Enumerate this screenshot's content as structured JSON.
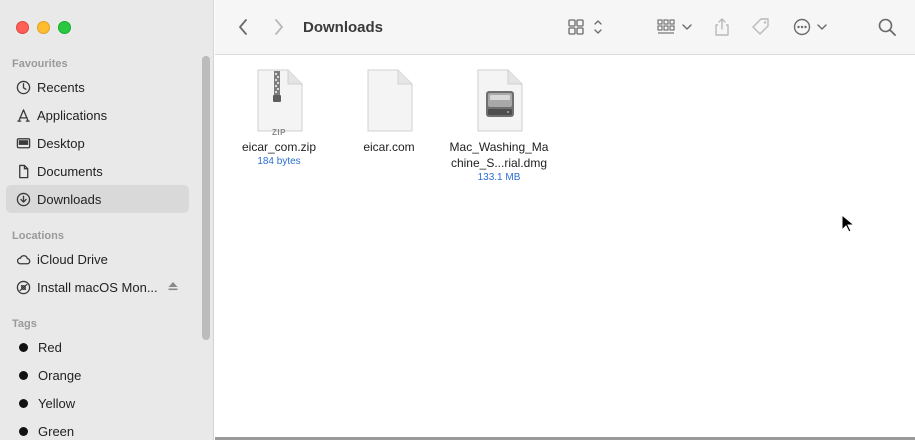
{
  "window": {
    "folder_title": "Downloads"
  },
  "sidebar": {
    "favourites_title": "Favourites",
    "favourites": [
      {
        "label": "Recents",
        "icon": "clock-icon"
      },
      {
        "label": "Applications",
        "icon": "applications-icon"
      },
      {
        "label": "Desktop",
        "icon": "desktop-icon"
      },
      {
        "label": "Documents",
        "icon": "document-icon"
      },
      {
        "label": "Downloads",
        "icon": "download-icon",
        "selected": true
      }
    ],
    "locations_title": "Locations",
    "locations": [
      {
        "label": "iCloud Drive",
        "icon": "cloud-icon"
      },
      {
        "label": "Install macOS Mon...",
        "icon": "disk-icon",
        "ejectable": true
      }
    ],
    "tags_title": "Tags",
    "tags": [
      {
        "label": "Red",
        "color": "#111111"
      },
      {
        "label": "Orange",
        "color": "#111111"
      },
      {
        "label": "Yellow",
        "color": "#111111"
      },
      {
        "label": "Green",
        "color": "#111111"
      }
    ]
  },
  "files": [
    {
      "name": "eicar_com.zip",
      "meta": "184 bytes",
      "type": "zip",
      "badge": "ZIP"
    },
    {
      "name": "eicar.com",
      "meta": "",
      "type": "blank"
    },
    {
      "name_line1": "Mac_Washing_Ma",
      "name_line2": "chine_S...rial.dmg",
      "meta": "133.1 MB",
      "type": "dmg"
    }
  ],
  "colors": {
    "accent": "#2c6fd4",
    "sidebar_bg": "#e9e9e9",
    "selected_bg": "#d9d9d9"
  }
}
